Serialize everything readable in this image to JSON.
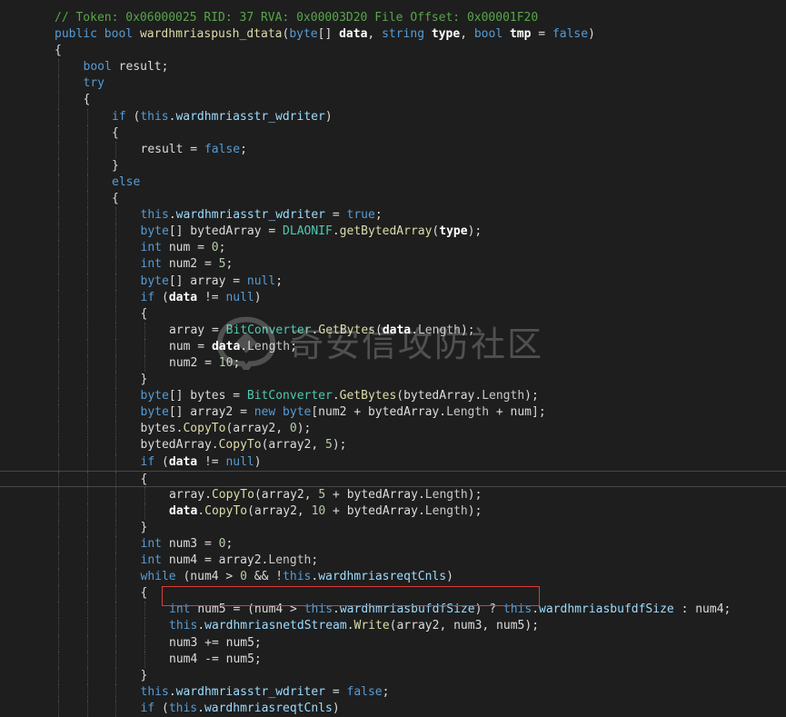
{
  "editor": {
    "lines": [
      {
        "indent": 0,
        "highlight": false,
        "tokens": [
          {
            "t": "// Token: 0x06000025 RID: 37 RVA: 0x00003D20 File Offset: 0x00001F20",
            "c": "comment"
          }
        ]
      },
      {
        "indent": 0,
        "highlight": false,
        "tokens": [
          {
            "t": "public ",
            "c": "kw"
          },
          {
            "t": "bool ",
            "c": "kw"
          },
          {
            "t": "wardhmriaspush_dtata",
            "c": "method"
          },
          {
            "t": "(",
            "c": "plain"
          },
          {
            "t": "byte",
            "c": "kw"
          },
          {
            "t": "[] ",
            "c": "plain"
          },
          {
            "t": "data",
            "c": "param"
          },
          {
            "t": ", ",
            "c": "plain"
          },
          {
            "t": "string ",
            "c": "kw"
          },
          {
            "t": "type",
            "c": "param"
          },
          {
            "t": ", ",
            "c": "plain"
          },
          {
            "t": "bool ",
            "c": "kw"
          },
          {
            "t": "tmp",
            "c": "param"
          },
          {
            "t": " = ",
            "c": "plain"
          },
          {
            "t": "false",
            "c": "kw"
          },
          {
            "t": ")",
            "c": "plain"
          }
        ]
      },
      {
        "indent": 0,
        "highlight": false,
        "tokens": [
          {
            "t": "{",
            "c": "plain"
          }
        ]
      },
      {
        "indent": 1,
        "highlight": false,
        "tokens": [
          {
            "t": "bool ",
            "c": "kw"
          },
          {
            "t": "result;",
            "c": "plain"
          }
        ]
      },
      {
        "indent": 1,
        "highlight": false,
        "tokens": [
          {
            "t": "try",
            "c": "kw"
          }
        ]
      },
      {
        "indent": 1,
        "highlight": false,
        "tokens": [
          {
            "t": "{",
            "c": "plain"
          }
        ]
      },
      {
        "indent": 2,
        "highlight": false,
        "tokens": [
          {
            "t": "if ",
            "c": "kw"
          },
          {
            "t": "(",
            "c": "plain"
          },
          {
            "t": "this",
            "c": "kw"
          },
          {
            "t": ".",
            "c": "plain"
          },
          {
            "t": "wardhmriasstr_wdriter",
            "c": "field"
          },
          {
            "t": ")",
            "c": "plain"
          }
        ]
      },
      {
        "indent": 2,
        "highlight": false,
        "tokens": [
          {
            "t": "{",
            "c": "plain"
          }
        ]
      },
      {
        "indent": 3,
        "highlight": false,
        "tokens": [
          {
            "t": "result = ",
            "c": "plain"
          },
          {
            "t": "false",
            "c": "kw"
          },
          {
            "t": ";",
            "c": "plain"
          }
        ]
      },
      {
        "indent": 2,
        "highlight": false,
        "tokens": [
          {
            "t": "}",
            "c": "plain"
          }
        ]
      },
      {
        "indent": 2,
        "highlight": false,
        "tokens": [
          {
            "t": "else",
            "c": "kw"
          }
        ]
      },
      {
        "indent": 2,
        "highlight": false,
        "tokens": [
          {
            "t": "{",
            "c": "plain"
          }
        ]
      },
      {
        "indent": 3,
        "highlight": false,
        "tokens": [
          {
            "t": "this",
            "c": "kw"
          },
          {
            "t": ".",
            "c": "plain"
          },
          {
            "t": "wardhmriasstr_wdriter",
            "c": "field"
          },
          {
            "t": " = ",
            "c": "plain"
          },
          {
            "t": "true",
            "c": "kw"
          },
          {
            "t": ";",
            "c": "plain"
          }
        ]
      },
      {
        "indent": 3,
        "highlight": false,
        "tokens": [
          {
            "t": "byte",
            "c": "kw"
          },
          {
            "t": "[] bytedArray = ",
            "c": "plain"
          },
          {
            "t": "DLAONIF",
            "c": "type"
          },
          {
            "t": ".",
            "c": "plain"
          },
          {
            "t": "getBytedArray",
            "c": "method"
          },
          {
            "t": "(",
            "c": "plain"
          },
          {
            "t": "type",
            "c": "param"
          },
          {
            "t": ");",
            "c": "plain"
          }
        ]
      },
      {
        "indent": 3,
        "highlight": false,
        "tokens": [
          {
            "t": "int ",
            "c": "kw"
          },
          {
            "t": "num = ",
            "c": "plain"
          },
          {
            "t": "0",
            "c": "num"
          },
          {
            "t": ";",
            "c": "plain"
          }
        ]
      },
      {
        "indent": 3,
        "highlight": false,
        "tokens": [
          {
            "t": "int ",
            "c": "kw"
          },
          {
            "t": "num2 = ",
            "c": "plain"
          },
          {
            "t": "5",
            "c": "num"
          },
          {
            "t": ";",
            "c": "plain"
          }
        ]
      },
      {
        "indent": 3,
        "highlight": false,
        "tokens": [
          {
            "t": "byte",
            "c": "kw"
          },
          {
            "t": "[] array = ",
            "c": "plain"
          },
          {
            "t": "null",
            "c": "kw"
          },
          {
            "t": ";",
            "c": "plain"
          }
        ]
      },
      {
        "indent": 3,
        "highlight": false,
        "tokens": [
          {
            "t": "if ",
            "c": "kw"
          },
          {
            "t": "(",
            "c": "plain"
          },
          {
            "t": "data",
            "c": "param"
          },
          {
            "t": " != ",
            "c": "plain"
          },
          {
            "t": "null",
            "c": "kw"
          },
          {
            "t": ")",
            "c": "plain"
          }
        ]
      },
      {
        "indent": 3,
        "highlight": false,
        "tokens": [
          {
            "t": "{",
            "c": "plain"
          }
        ]
      },
      {
        "indent": 4,
        "highlight": false,
        "tokens": [
          {
            "t": "array = ",
            "c": "plain"
          },
          {
            "t": "BitConverter",
            "c": "type"
          },
          {
            "t": ".",
            "c": "plain"
          },
          {
            "t": "GetBytes",
            "c": "method"
          },
          {
            "t": "(",
            "c": "plain"
          },
          {
            "t": "data",
            "c": "param"
          },
          {
            "t": ".",
            "c": "plain"
          },
          {
            "t": "Length",
            "c": "prop"
          },
          {
            "t": ");",
            "c": "plain"
          }
        ]
      },
      {
        "indent": 4,
        "highlight": false,
        "tokens": [
          {
            "t": "num = ",
            "c": "plain"
          },
          {
            "t": "data",
            "c": "param"
          },
          {
            "t": ".",
            "c": "plain"
          },
          {
            "t": "Length",
            "c": "prop"
          },
          {
            "t": ";",
            "c": "plain"
          }
        ]
      },
      {
        "indent": 4,
        "highlight": false,
        "tokens": [
          {
            "t": "num2 = ",
            "c": "plain"
          },
          {
            "t": "10",
            "c": "num"
          },
          {
            "t": ";",
            "c": "plain"
          }
        ]
      },
      {
        "indent": 3,
        "highlight": false,
        "tokens": [
          {
            "t": "}",
            "c": "plain"
          }
        ]
      },
      {
        "indent": 3,
        "highlight": false,
        "tokens": [
          {
            "t": "byte",
            "c": "kw"
          },
          {
            "t": "[] bytes = ",
            "c": "plain"
          },
          {
            "t": "BitConverter",
            "c": "type"
          },
          {
            "t": ".",
            "c": "plain"
          },
          {
            "t": "GetBytes",
            "c": "method"
          },
          {
            "t": "(bytedArray.",
            "c": "plain"
          },
          {
            "t": "Length",
            "c": "prop"
          },
          {
            "t": ");",
            "c": "plain"
          }
        ]
      },
      {
        "indent": 3,
        "highlight": false,
        "tokens": [
          {
            "t": "byte",
            "c": "kw"
          },
          {
            "t": "[] array2 = ",
            "c": "plain"
          },
          {
            "t": "new ",
            "c": "kw"
          },
          {
            "t": "byte",
            "c": "kw"
          },
          {
            "t": "[num2 + bytedArray.",
            "c": "plain"
          },
          {
            "t": "Length",
            "c": "prop"
          },
          {
            "t": " + num];",
            "c": "plain"
          }
        ]
      },
      {
        "indent": 3,
        "highlight": false,
        "tokens": [
          {
            "t": "bytes.",
            "c": "plain"
          },
          {
            "t": "CopyTo",
            "c": "method"
          },
          {
            "t": "(array2, ",
            "c": "plain"
          },
          {
            "t": "0",
            "c": "num"
          },
          {
            "t": ");",
            "c": "plain"
          }
        ]
      },
      {
        "indent": 3,
        "highlight": false,
        "tokens": [
          {
            "t": "bytedArray.",
            "c": "plain"
          },
          {
            "t": "CopyTo",
            "c": "method"
          },
          {
            "t": "(array2, ",
            "c": "plain"
          },
          {
            "t": "5",
            "c": "num"
          },
          {
            "t": ");",
            "c": "plain"
          }
        ]
      },
      {
        "indent": 3,
        "highlight": false,
        "tokens": [
          {
            "t": "if ",
            "c": "kw"
          },
          {
            "t": "(",
            "c": "plain"
          },
          {
            "t": "data",
            "c": "param"
          },
          {
            "t": " != ",
            "c": "plain"
          },
          {
            "t": "null",
            "c": "kw"
          },
          {
            "t": ")",
            "c": "plain"
          }
        ]
      },
      {
        "indent": 3,
        "highlight": true,
        "tokens": [
          {
            "t": "{",
            "c": "plain"
          }
        ]
      },
      {
        "indent": 4,
        "highlight": false,
        "tokens": [
          {
            "t": "array.",
            "c": "plain"
          },
          {
            "t": "CopyTo",
            "c": "method"
          },
          {
            "t": "(array2, ",
            "c": "plain"
          },
          {
            "t": "5",
            "c": "num"
          },
          {
            "t": " + bytedArray.",
            "c": "plain"
          },
          {
            "t": "Length",
            "c": "prop"
          },
          {
            "t": ");",
            "c": "plain"
          }
        ]
      },
      {
        "indent": 4,
        "highlight": false,
        "tokens": [
          {
            "t": "data",
            "c": "param"
          },
          {
            "t": ".",
            "c": "plain"
          },
          {
            "t": "CopyTo",
            "c": "method"
          },
          {
            "t": "(array2, ",
            "c": "plain"
          },
          {
            "t": "10",
            "c": "num"
          },
          {
            "t": " + bytedArray.",
            "c": "plain"
          },
          {
            "t": "Length",
            "c": "prop"
          },
          {
            "t": ");",
            "c": "plain"
          }
        ]
      },
      {
        "indent": 3,
        "highlight": false,
        "tokens": [
          {
            "t": "}",
            "c": "plain"
          }
        ]
      },
      {
        "indent": 3,
        "highlight": false,
        "tokens": [
          {
            "t": "int ",
            "c": "kw"
          },
          {
            "t": "num3 = ",
            "c": "plain"
          },
          {
            "t": "0",
            "c": "num"
          },
          {
            "t": ";",
            "c": "plain"
          }
        ]
      },
      {
        "indent": 3,
        "highlight": false,
        "tokens": [
          {
            "t": "int ",
            "c": "kw"
          },
          {
            "t": "num4 = array2.",
            "c": "plain"
          },
          {
            "t": "Length",
            "c": "prop"
          },
          {
            "t": ";",
            "c": "plain"
          }
        ]
      },
      {
        "indent": 3,
        "highlight": false,
        "tokens": [
          {
            "t": "while ",
            "c": "kw"
          },
          {
            "t": "(num4 > ",
            "c": "plain"
          },
          {
            "t": "0",
            "c": "num"
          },
          {
            "t": " && !",
            "c": "plain"
          },
          {
            "t": "this",
            "c": "kw"
          },
          {
            "t": ".",
            "c": "plain"
          },
          {
            "t": "wardhmriasreqtCnls",
            "c": "field"
          },
          {
            "t": ")",
            "c": "plain"
          }
        ]
      },
      {
        "indent": 3,
        "highlight": false,
        "tokens": [
          {
            "t": "{",
            "c": "plain"
          }
        ]
      },
      {
        "indent": 4,
        "highlight": false,
        "tokens": [
          {
            "t": "int ",
            "c": "kw"
          },
          {
            "t": "num5 = (num4 > ",
            "c": "plain"
          },
          {
            "t": "this",
            "c": "kw"
          },
          {
            "t": ".",
            "c": "plain"
          },
          {
            "t": "wardhmriasbufdfSize",
            "c": "field"
          },
          {
            "t": ") ? ",
            "c": "plain"
          },
          {
            "t": "this",
            "c": "kw"
          },
          {
            "t": ".",
            "c": "plain"
          },
          {
            "t": "wardhmriasbufdfSize",
            "c": "field"
          },
          {
            "t": " : num4;",
            "c": "plain"
          }
        ]
      },
      {
        "indent": 4,
        "highlight": false,
        "tokens": [
          {
            "t": "this",
            "c": "kw"
          },
          {
            "t": ".",
            "c": "plain"
          },
          {
            "t": "wardhmriasnetdStream",
            "c": "field"
          },
          {
            "t": ".",
            "c": "plain"
          },
          {
            "t": "Write",
            "c": "method"
          },
          {
            "t": "(array2, num3, num5);",
            "c": "plain"
          }
        ]
      },
      {
        "indent": 4,
        "highlight": false,
        "tokens": [
          {
            "t": "num3 += num5;",
            "c": "plain"
          }
        ]
      },
      {
        "indent": 4,
        "highlight": false,
        "tokens": [
          {
            "t": "num4 -= num5;",
            "c": "plain"
          }
        ]
      },
      {
        "indent": 3,
        "highlight": false,
        "tokens": [
          {
            "t": "}",
            "c": "plain"
          }
        ]
      },
      {
        "indent": 3,
        "highlight": false,
        "tokens": [
          {
            "t": "this",
            "c": "kw"
          },
          {
            "t": ".",
            "c": "plain"
          },
          {
            "t": "wardhmriasstr_wdriter",
            "c": "field"
          },
          {
            "t": " = ",
            "c": "plain"
          },
          {
            "t": "false",
            "c": "kw"
          },
          {
            "t": ";",
            "c": "plain"
          }
        ]
      },
      {
        "indent": 3,
        "highlight": false,
        "tokens": [
          {
            "t": "if ",
            "c": "kw"
          },
          {
            "t": "(",
            "c": "plain"
          },
          {
            "t": "this",
            "c": "kw"
          },
          {
            "t": ".",
            "c": "plain"
          },
          {
            "t": "wardhmriasreqtCnls",
            "c": "field"
          },
          {
            "t": ")",
            "c": "plain"
          }
        ]
      }
    ]
  },
  "watermark": {
    "text": "奇安信攻防社区"
  },
  "colors": {
    "background": "#1e1e1e",
    "keyword": "#569cd6",
    "type": "#4ec9b0",
    "method": "#dcdcaa",
    "comment": "#57a64a",
    "number": "#b5cea8",
    "field": "#9cdcfe",
    "annotation_box": "#e03a3a"
  }
}
